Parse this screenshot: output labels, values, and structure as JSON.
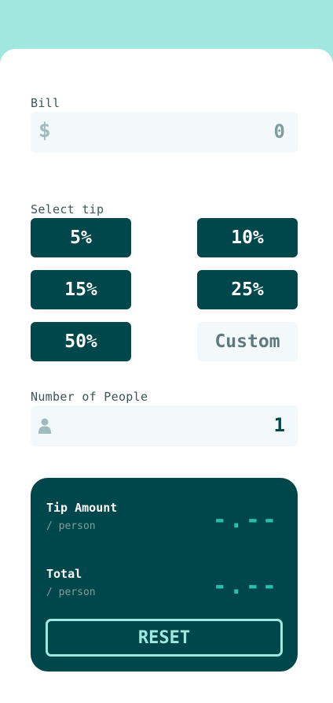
{
  "bill": {
    "label": "Bill",
    "currency_symbol": "$",
    "value": "0"
  },
  "tip": {
    "label": "Select tip",
    "options": [
      "5%",
      "10%",
      "15%",
      "25%",
      "50%"
    ],
    "custom_placeholder": "Custom"
  },
  "people": {
    "label": "Number of People",
    "value": "1",
    "icon": "person-icon"
  },
  "results": {
    "tip_amount": {
      "title": "Tip Amount",
      "sub": "/ person",
      "value": "-.--"
    },
    "total": {
      "title": "Total",
      "sub": "/ person",
      "value": "-.--"
    }
  },
  "reset_label": "RESET",
  "colors": {
    "background": "#a0e8df",
    "card": "#ffffff",
    "dark": "#00474b",
    "input_bg": "#f3f8fb",
    "accent": "#9fe8df"
  }
}
